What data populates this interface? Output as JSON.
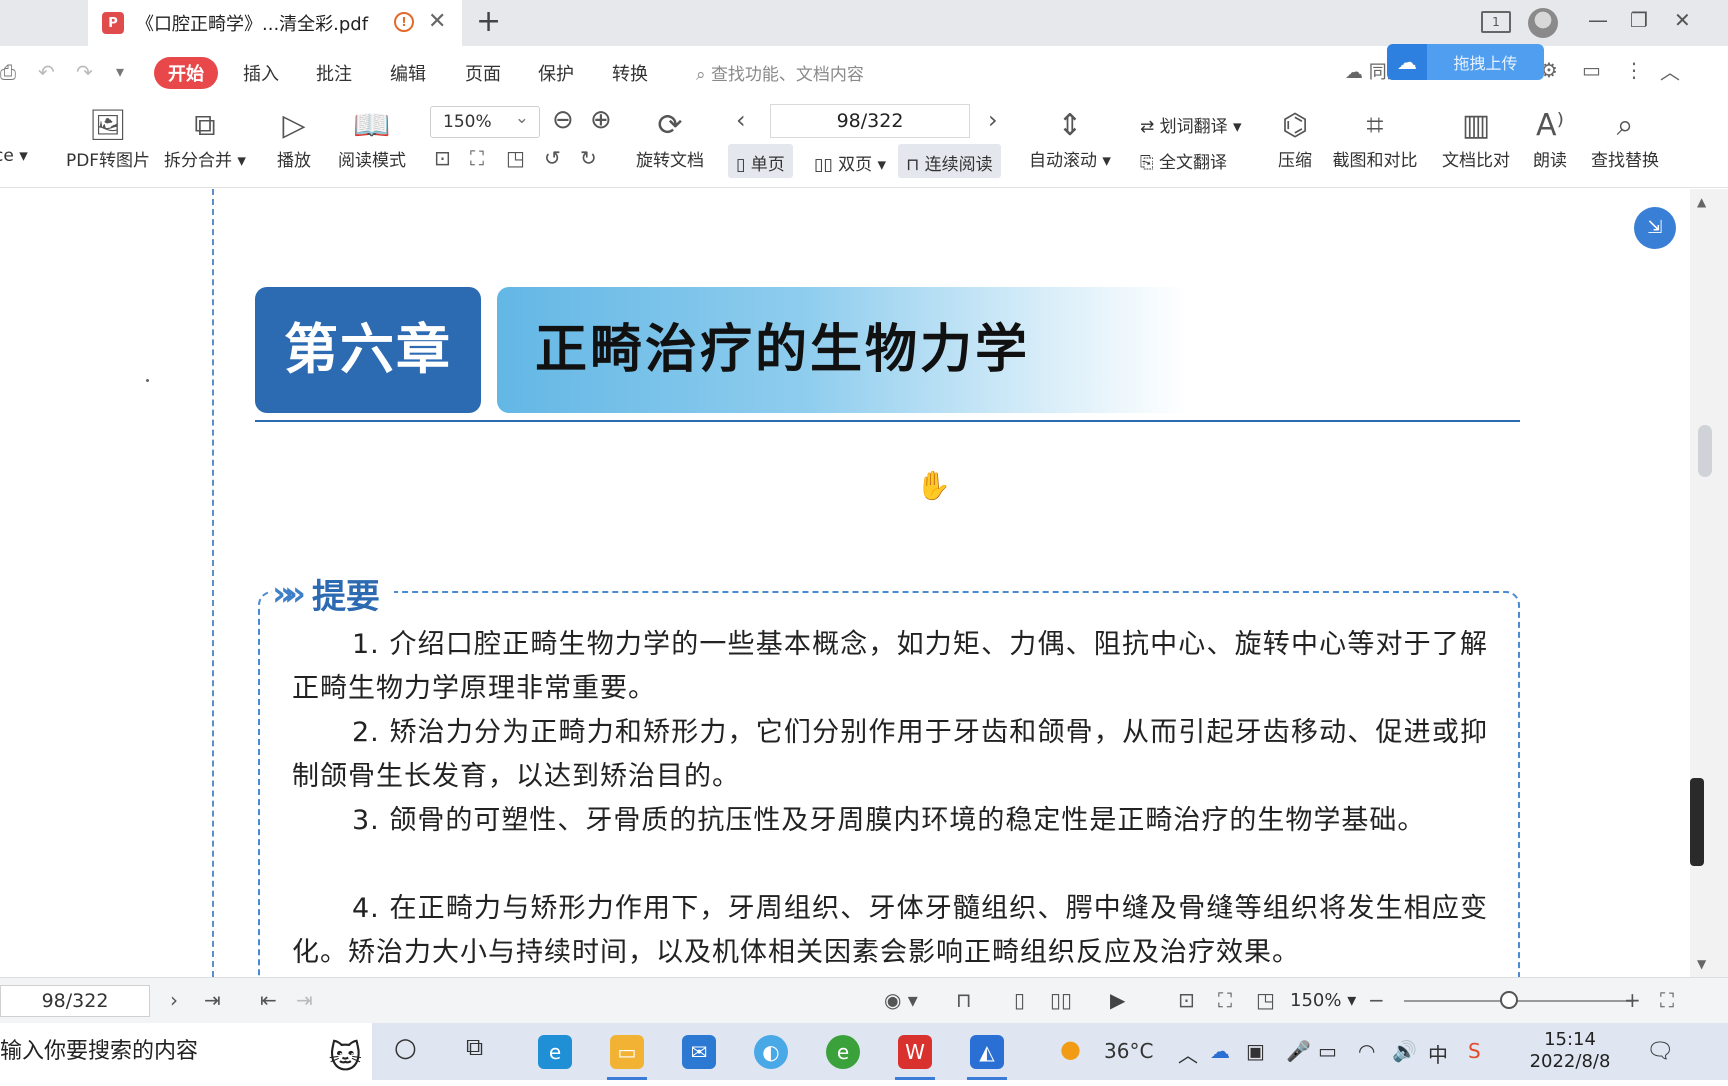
{
  "titlebar": {
    "tab_title": "《口腔正畸学》...清全彩.pdf",
    "layout_badge": "1"
  },
  "menu": {
    "items": [
      "开始",
      "插入",
      "批注",
      "编辑",
      "页面",
      "保护",
      "转换"
    ],
    "search_placeholder": "查找功能、文档内容",
    "sync_label": "同步保存",
    "cloud_upload": "拖拽上传"
  },
  "toolbar": {
    "pdf_to_image": "PDF转图片",
    "split_merge": "拆分合并",
    "play": "播放",
    "read_mode": "阅读模式",
    "zoom": "150%",
    "rotate_doc": "旋转文档",
    "page_indicator": "98/322",
    "single_page": "单页",
    "double_page": "双页",
    "continuous": "连续阅读",
    "auto_scroll": "自动滚动",
    "word_translate": "划词翻译",
    "full_translate": "全文翻译",
    "compress": "压缩",
    "screenshot_compare": "截图和对比",
    "doc_compare": "文档比对",
    "read_aloud": "朗读",
    "find_replace": "查找替换"
  },
  "document": {
    "chapter_number": "第六章",
    "chapter_title": "正畸治疗的生物力学",
    "summary_label": "提要",
    "paragraphs": [
      "1. 介绍口腔正畸生物力学的一些基本概念，如力矩、力偶、阻抗中心、旋转中心等对于了解正畸生物力学原理非常重要。",
      "2. 矫治力分为正畸力和矫形力，它们分别作用于牙齿和颌骨，从而引起牙齿移动、促进或抑制颌骨生长发育，以达到矫治目的。",
      "3. 颌骨的可塑性、牙骨质的抗压性及牙周膜内环境的稳定性是正畸治疗的生物学基础。",
      "4. 在正畸力与矫形力作用下，牙周组织、牙体牙髓组织、腭中缝及骨缝等组织将发生相应变化。矫治力大小与持续时间，以及机体相关因素会影响正畸组织反应及治疗效果。"
    ]
  },
  "statusbar": {
    "page": "98/322",
    "zoom": "150%"
  },
  "taskbar": {
    "search_placeholder": "输入你要搜索的内容",
    "temperature": "36°C",
    "ime": "中",
    "time": "15:14",
    "date": "2022/8/8"
  },
  "colors": {
    "accent_red": "#e9484b",
    "chapter_blue": "#2c6bb2",
    "dashed_border": "#4a8ad0"
  }
}
